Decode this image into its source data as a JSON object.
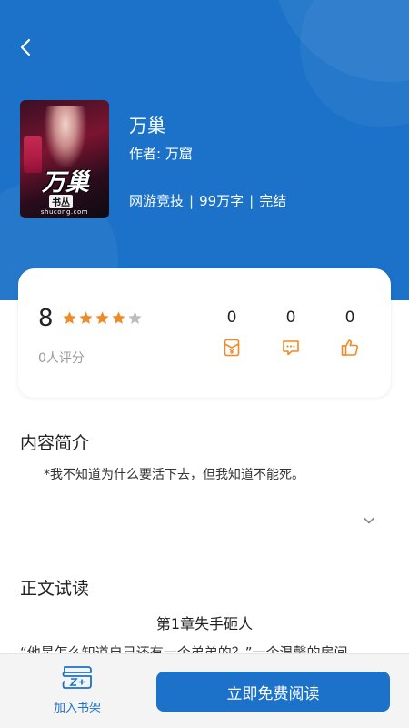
{
  "book": {
    "title": "万巢",
    "author": "作者: 万窟",
    "category": "网游竞技",
    "word_count": "99万字",
    "status": "完结",
    "cover": {
      "title": "万巢",
      "logo": "书丛",
      "site": "shucong.com"
    }
  },
  "meta_separator": "|",
  "rating": {
    "score": "8",
    "stars_filled": 4,
    "stars_total": 5,
    "count_label": "0人评分",
    "stats": [
      {
        "value": "0",
        "icon": "red-envelope-icon"
      },
      {
        "value": "0",
        "icon": "comment-icon"
      },
      {
        "value": "0",
        "icon": "thumbs-up-icon"
      }
    ]
  },
  "intro": {
    "title": "内容简介",
    "text": "*我不知道为什么要活下去，但我知道不能死。"
  },
  "trial": {
    "title": "正文试读",
    "chapter_title": "第1章失手砸人",
    "chapter_text": "“他是怎么知道自己还有一个弟弟的？”一个温馨的房间"
  },
  "bottom": {
    "shelf_label": "加入书架",
    "read_label": "立即免费阅读"
  },
  "colors": {
    "primary": "#1b72c8",
    "star": "#f08a24",
    "star_empty": "#bdbdbd",
    "stat_icon": "#f08a24"
  }
}
